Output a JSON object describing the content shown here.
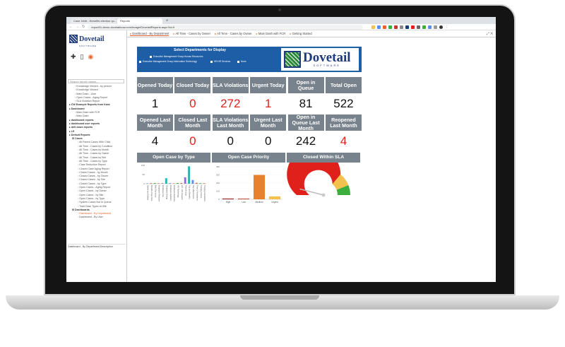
{
  "browser": {
    "tabs": [
      {
        "label": "Case 1646 - Benefits election qu..."
      },
      {
        "label": "Reports"
      }
    ],
    "url": "report01.demo.dovetailnow.com/Image/DovetailReports.aspx?id=0"
  },
  "sidebar": {
    "logo_text": "Dovetail",
    "logo_sub": "SOFTWARE",
    "search_placeholder": "Search report names...",
    "items": [
      {
        "label": "Knowledge Viewed - by person",
        "level": 2
      },
      {
        "label": "Knowledge Viewed",
        "level": 2
      },
      {
        "label": "Main Dash - User",
        "level": 2
      },
      {
        "label": "Open Cases - Aging Report",
        "level": 2
      },
      {
        "label": "SLA Violation Report",
        "level": 2
      },
      {
        "label": "CW Example Reports from Kane",
        "level": 0
      },
      {
        "label": "Dashboard",
        "level": 0
      },
      {
        "label": "Main Dash with FCR",
        "level": 2
      },
      {
        "label": "Main Dash",
        "level": 2
      },
      {
        "label": "dashboard reports",
        "level": 0
      },
      {
        "label": "dashboard user reports",
        "level": 0
      },
      {
        "label": "drill down reports",
        "level": 0
      },
      {
        "label": "LE",
        "level": 0
      },
      {
        "label": "Default Reports",
        "level": 0
      },
      {
        "label": "Cases",
        "level": 1
      },
      {
        "label": "All Parent Cases With Child",
        "level": 3
      },
      {
        "label": "All Time - Cases by Condition",
        "level": 3
      },
      {
        "label": "All Time - Cases by Month",
        "level": 3
      },
      {
        "label": "All Time - Cases by Owner",
        "level": 3
      },
      {
        "label": "All Time - Cases by Site",
        "level": 3
      },
      {
        "label": "All Time - Cases by Type",
        "level": 3
      },
      {
        "label": "Case Reduction Report",
        "level": 3
      },
      {
        "label": "Closed Case Aging Report",
        "level": 3
      },
      {
        "label": "Closed Cases - by Month",
        "level": 3
      },
      {
        "label": "Closed Cases - by Owner",
        "level": 3
      },
      {
        "label": "Closed Cases - by Site",
        "level": 3
      },
      {
        "label": "Closed Cases - by Type",
        "level": 3
      },
      {
        "label": "Open Cases - Aging Report",
        "level": 3
      },
      {
        "label": "Open Cases - by Owner",
        "level": 3
      },
      {
        "label": "Open Cases - by Site",
        "level": 3
      },
      {
        "label": "Open Cases - by Type",
        "level": 3
      },
      {
        "label": "System Cases Not in Queue",
        "level": 3
      },
      {
        "label": "Total Case Types at Site",
        "level": 3
      },
      {
        "label": "Dashboards",
        "level": 1
      },
      {
        "label": "Dashboard - By Department",
        "level": 3,
        "selected": true
      },
      {
        "label": "Dashboard - By User",
        "level": 3
      }
    ],
    "footer": "Dashboard - By Department Description"
  },
  "report_tabs": [
    {
      "label": "Dashboard - By Department",
      "active": true
    },
    {
      "label": "All Time - Cases by Owner"
    },
    {
      "label": "All Time - Cases by Owner"
    },
    {
      "label": "Main Dash with FCR"
    },
    {
      "label": "Getting Started"
    }
  ],
  "banner": {
    "title": "Select Departments for Display",
    "options": [
      "Executive Management Group:Human Resources",
      "Executive Management Group:Information Technology",
      "HR:HR Services",
      "None"
    ],
    "logo_text": "Dovetail",
    "logo_sub": "SOFTWARE"
  },
  "kpis_row1": [
    {
      "label": "Opened Today",
      "value": "1",
      "color": "#111111"
    },
    {
      "label": "Closed Today",
      "value": "0",
      "color": "#e0201b"
    },
    {
      "label": "SLA Violations",
      "value": "272",
      "color": "#e0201b"
    },
    {
      "label": "Urgent Today",
      "value": "1",
      "color": "#e0201b"
    },
    {
      "label": "Open in Queue",
      "value": "81",
      "color": "#111111"
    },
    {
      "label": "Total Open",
      "value": "522",
      "color": "#111111"
    }
  ],
  "kpis_row2": [
    {
      "label": "Opened Last Month",
      "value": "4",
      "color": "#111111"
    },
    {
      "label": "Closed Last Month",
      "value": "0",
      "color": "#e0201b"
    },
    {
      "label": "SLA Violations Last Month",
      "value": "0",
      "color": "#111111"
    },
    {
      "label": "Urgent Last Month",
      "value": "0",
      "color": "#111111"
    },
    {
      "label": "Open in Queue Last Month",
      "value": "242",
      "color": "#111111"
    },
    {
      "label": "Reopened Last Month",
      "value": "4",
      "color": "#e0201b"
    }
  ],
  "charts": {
    "open_case_by_type": {
      "title": "Open Case by Type"
    },
    "open_case_priority": {
      "title": "Open Case Priority"
    },
    "closed_within_sla": {
      "title": "Closed Within SLA"
    }
  },
  "chart_data": [
    {
      "type": "bar",
      "title": "Open Case by Type",
      "categories": [
        "Admin and Dollars",
        "Benefits Page Rem",
        "Bulk Pay Issue",
        "Employee Relations",
        "Employee Fee",
        "Employee Dedup",
        "Employee Updates",
        "Employee Relations",
        "HR Technology",
        "HR - Info Request",
        "Payroll Issue",
        "Pay and Benefits",
        "Pay Adjustments",
        "Time & Attendance",
        "Training Course",
        "Training Cancellatio"
      ],
      "values": [
        2,
        3,
        4,
        2,
        3,
        30,
        3,
        2,
        4,
        3,
        35,
        95,
        20,
        5,
        3,
        2
      ],
      "ylim": [
        0,
        100
      ]
    },
    {
      "type": "bar",
      "title": "Open Case Priority",
      "categories": [
        "High",
        "Low",
        "Medium",
        "Urgent"
      ],
      "values": [
        9,
        8,
        300,
        36
      ],
      "colors": [
        "#8b1c1c",
        "#c0392b",
        "#e8822a",
        "#f2c14e"
      ],
      "ylim": [
        0,
        400
      ]
    },
    {
      "type": "gauge",
      "title": "Closed Within SLA",
      "value": 8,
      "bands": [
        {
          "from": 0,
          "to": 72,
          "color": "#e0201b"
        },
        {
          "from": 72,
          "to": 88,
          "color": "#f2c14e"
        },
        {
          "from": 88,
          "to": 100,
          "color": "#3cae3c"
        }
      ]
    }
  ]
}
